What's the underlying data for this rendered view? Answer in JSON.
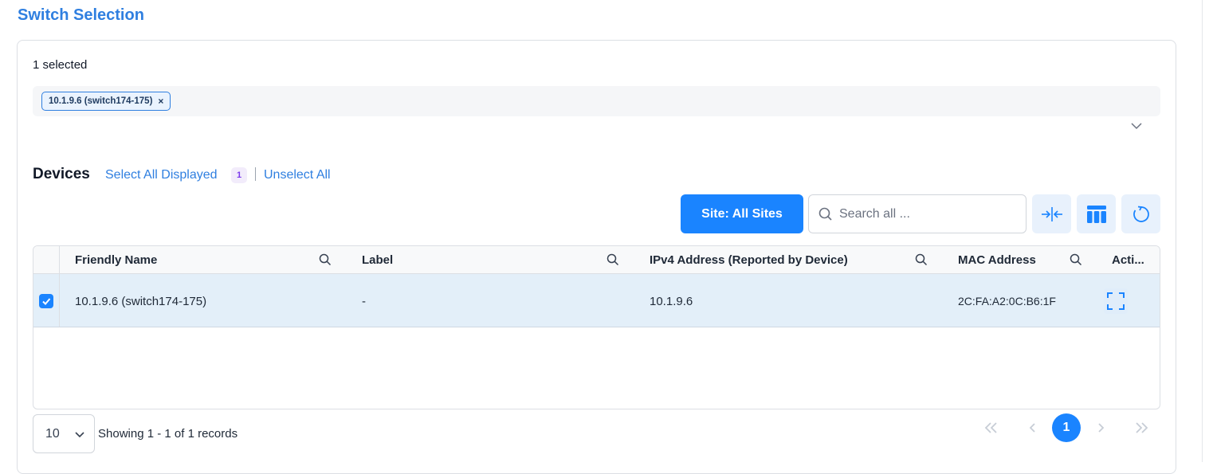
{
  "page": {
    "title": "Switch Selection"
  },
  "selection": {
    "count_text": "1 selected",
    "chips": [
      {
        "label": "10.1.9.6 (switch174-175)",
        "remove": "×"
      }
    ]
  },
  "devices": {
    "title": "Devices",
    "select_all_label": "Select All Displayed",
    "selected_badge": "1",
    "unselect_all_label": "Unselect All"
  },
  "toolbar": {
    "site_button": "Site:  All Sites",
    "search_placeholder": "Search all ...",
    "icons": [
      "collapse-columns-icon",
      "column-layout-icon",
      "refresh-icon"
    ]
  },
  "table": {
    "columns": [
      "Friendly Name",
      "Label",
      "IPv4 Address (Reported by Device)",
      "MAC Address",
      "Acti..."
    ],
    "rows": [
      {
        "checked": true,
        "friendly_name": "10.1.9.6 (switch174-175)",
        "label": "-",
        "ipv4": "10.1.9.6",
        "mac": "2C:FA:A2:0C:B6:1F"
      }
    ]
  },
  "pagination": {
    "page_size": "10",
    "records_text": "Showing 1 - 1 of 1 records",
    "current_page": "1"
  },
  "colors": {
    "accent": "#1a84ff",
    "title": "#2f7fe0",
    "row_selected": "#e3eff9",
    "badge_text": "#7c3aed"
  }
}
